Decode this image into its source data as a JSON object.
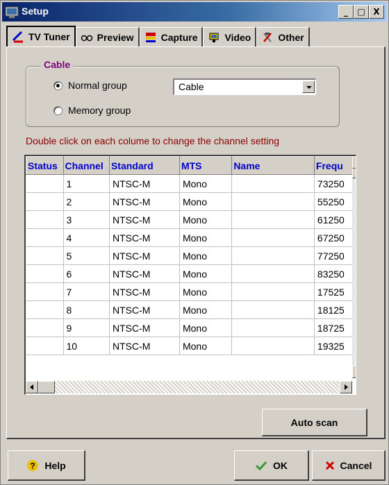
{
  "window": {
    "title": "Setup"
  },
  "titlebar_buttons": {
    "minimize": "_",
    "maximize": "□",
    "close": "X"
  },
  "tabs": [
    {
      "label": "TV Tuner",
      "icon": "satellite-dish-icon",
      "active": true
    },
    {
      "label": "Preview",
      "icon": "glasses-icon",
      "active": false
    },
    {
      "label": "Capture",
      "icon": "film-capture-icon",
      "active": false
    },
    {
      "label": "Video",
      "icon": "tv-icon",
      "active": false
    },
    {
      "label": "Other",
      "icon": "tools-icon",
      "active": false
    }
  ],
  "cable_group": {
    "title": "Cable",
    "options": [
      {
        "label": "Normal group",
        "selected": true
      },
      {
        "label": "Memory group",
        "selected": false
      }
    ],
    "source_select": "Cable"
  },
  "hint": "Double click on each colume to change the channel setting",
  "grid": {
    "columns": [
      "Status",
      "Channel",
      "Standard",
      "MTS",
      "Name",
      "Frequ"
    ],
    "rows": [
      [
        "",
        "1",
        "NTSC-M",
        "Mono",
        "",
        "73250"
      ],
      [
        "",
        "2",
        "NTSC-M",
        "Mono",
        "",
        "55250"
      ],
      [
        "",
        "3",
        "NTSC-M",
        "Mono",
        "",
        "61250"
      ],
      [
        "",
        "4",
        "NTSC-M",
        "Mono",
        "",
        "67250"
      ],
      [
        "",
        "5",
        "NTSC-M",
        "Mono",
        "",
        "77250"
      ],
      [
        "",
        "6",
        "NTSC-M",
        "Mono",
        "",
        "83250"
      ],
      [
        "",
        "7",
        "NTSC-M",
        "Mono",
        "",
        "17525"
      ],
      [
        "",
        "8",
        "NTSC-M",
        "Mono",
        "",
        "18125"
      ],
      [
        "",
        "9",
        "NTSC-M",
        "Mono",
        "",
        "18725"
      ],
      [
        "",
        "10",
        "NTSC-M",
        "Mono",
        "",
        "19325"
      ]
    ]
  },
  "buttons": {
    "auto_scan": "Auto scan",
    "help": "Help",
    "ok": "OK",
    "cancel": "Cancel"
  },
  "colors": {
    "titlebar": "#0a246a",
    "group_title": "#800080",
    "hint": "#8b0000",
    "header_text": "#0000cc",
    "ok_check": "#3a9a3a",
    "cancel_x": "#cc0000",
    "help_icon": "#e8c000"
  }
}
